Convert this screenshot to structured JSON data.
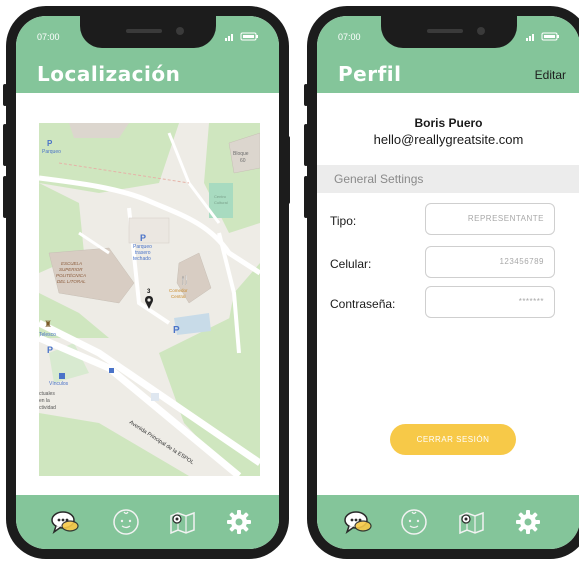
{
  "colors": {
    "accent": "#84c59a",
    "button": "#f7c948",
    "frame": "#1c1c1c"
  },
  "left_screen": {
    "time": "07:00",
    "title": "Localización",
    "map": {
      "labels": {
        "parqueo": "Parqueo",
        "bloque": "Bloque",
        "bloque_num": "60",
        "centro": "Centro",
        "centro_2": "Cultural",
        "parqueo_trasero_1": "Parqueo",
        "parqueo_trasero_2": "trasero",
        "parqueo_trasero_3": "techado",
        "escuela_1": "ESCUELA",
        "escuela_2": "SUPERIOR",
        "escuela_3": "POLITÉCNICA",
        "escuela_4": "DEL LITORAL",
        "comedor_1": "Comedor",
        "comedor_2": "Central",
        "pin_number": "3",
        "telesco": "Telesco",
        "vinculos": "Vínculos",
        "actividad_1": "ctuales",
        "actividad_2": "en la",
        "actividad_3": "ctividad",
        "avenida": "Avenida Principal de la ESPOL",
        "p": "P"
      }
    },
    "nav": [
      "chat-icon",
      "baby-face-icon",
      "map-icon",
      "gear-icon"
    ]
  },
  "right_screen": {
    "time": "07:00",
    "title": "Perfil",
    "edit_label": "Editar",
    "name": "Boris Puero",
    "email": "hello@reallygreatsite.com",
    "section_title": "General Settings",
    "fields": [
      {
        "label": "Tipo:",
        "value": "REPRESENTANTE"
      },
      {
        "label": "Celular:",
        "value": "123456789"
      },
      {
        "label": "Contraseña:",
        "value": "*******"
      }
    ],
    "logout_label": "CERRAR SESIÓN",
    "nav": [
      "chat-icon",
      "baby-face-icon",
      "map-icon",
      "gear-icon"
    ]
  }
}
